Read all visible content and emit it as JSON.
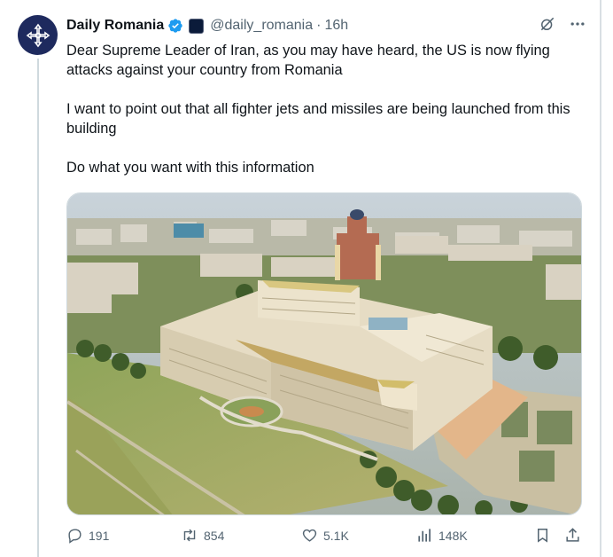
{
  "tweet": {
    "display_name": "Daily Romania",
    "handle": "@daily_romania",
    "separator": "·",
    "time": "16h",
    "text": [
      "Dear Supreme Leader of Iran, as you may have heard, the US is now flying attacks against your country from Romania",
      "I want to point out that all fighter jets and missiles are being launched from this building",
      "Do what you want with this information"
    ]
  },
  "icons": {
    "avatar": "cross-emblem-icon",
    "verified": "verified-badge-icon",
    "affiliate": "affiliate-badge-icon",
    "grok": "grok-icon",
    "more": "more-icon",
    "reply": "reply-icon",
    "repost": "repost-icon",
    "like": "like-icon",
    "views": "views-icon",
    "bookmark": "bookmark-icon",
    "share": "share-icon"
  },
  "stats": {
    "replies": "191",
    "reposts": "854",
    "likes": "5.1K",
    "views": "148K"
  },
  "colors": {
    "text": "#0f1419",
    "secondary": "#536471",
    "verified": "#1d9bf0",
    "avatar_bg": "#1e2a5e"
  }
}
